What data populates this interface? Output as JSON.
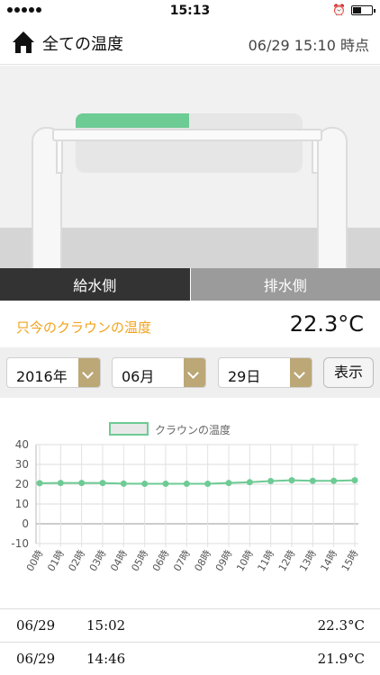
{
  "status_bar": {
    "time": "15:13"
  },
  "nav": {
    "title": "全ての温度",
    "updated": "06/29 15:10 時点"
  },
  "illustration": {
    "crown_fill_fraction": 0.5,
    "fill_color": "#6dcb94"
  },
  "tabs": [
    {
      "label": "給水側",
      "active": true
    },
    {
      "label": "排水側",
      "active": false
    }
  ],
  "current": {
    "label": "只今のクラウンの温度",
    "value": "22.3°C"
  },
  "selectors": {
    "year": "2016年",
    "month": "06月",
    "day": "29日",
    "show_label": "表示"
  },
  "chart_data": {
    "type": "line",
    "legend": "クラウンの温度",
    "categories": [
      "00時",
      "01時",
      "02時",
      "03時",
      "04時",
      "05時",
      "06時",
      "07時",
      "08時",
      "09時",
      "10時",
      "11時",
      "12時",
      "13時",
      "14時",
      "15時"
    ],
    "series": [
      {
        "name": "クラウンの温度",
        "values": [
          20.5,
          20.6,
          20.6,
          20.6,
          20.3,
          20.2,
          20.2,
          20.2,
          20.2,
          20.6,
          21.0,
          21.6,
          22.0,
          21.7,
          21.7,
          22.0
        ]
      }
    ],
    "yticks": [
      40,
      30,
      20,
      10,
      0,
      -10
    ],
    "ylim": [
      -10,
      40
    ],
    "grid": true,
    "line_color": "#6dcb94"
  },
  "readings": [
    {
      "date": "06/29",
      "time": "15:02",
      "value": "22.3°C"
    },
    {
      "date": "06/29",
      "time": "14:46",
      "value": "21.9°C"
    }
  ]
}
